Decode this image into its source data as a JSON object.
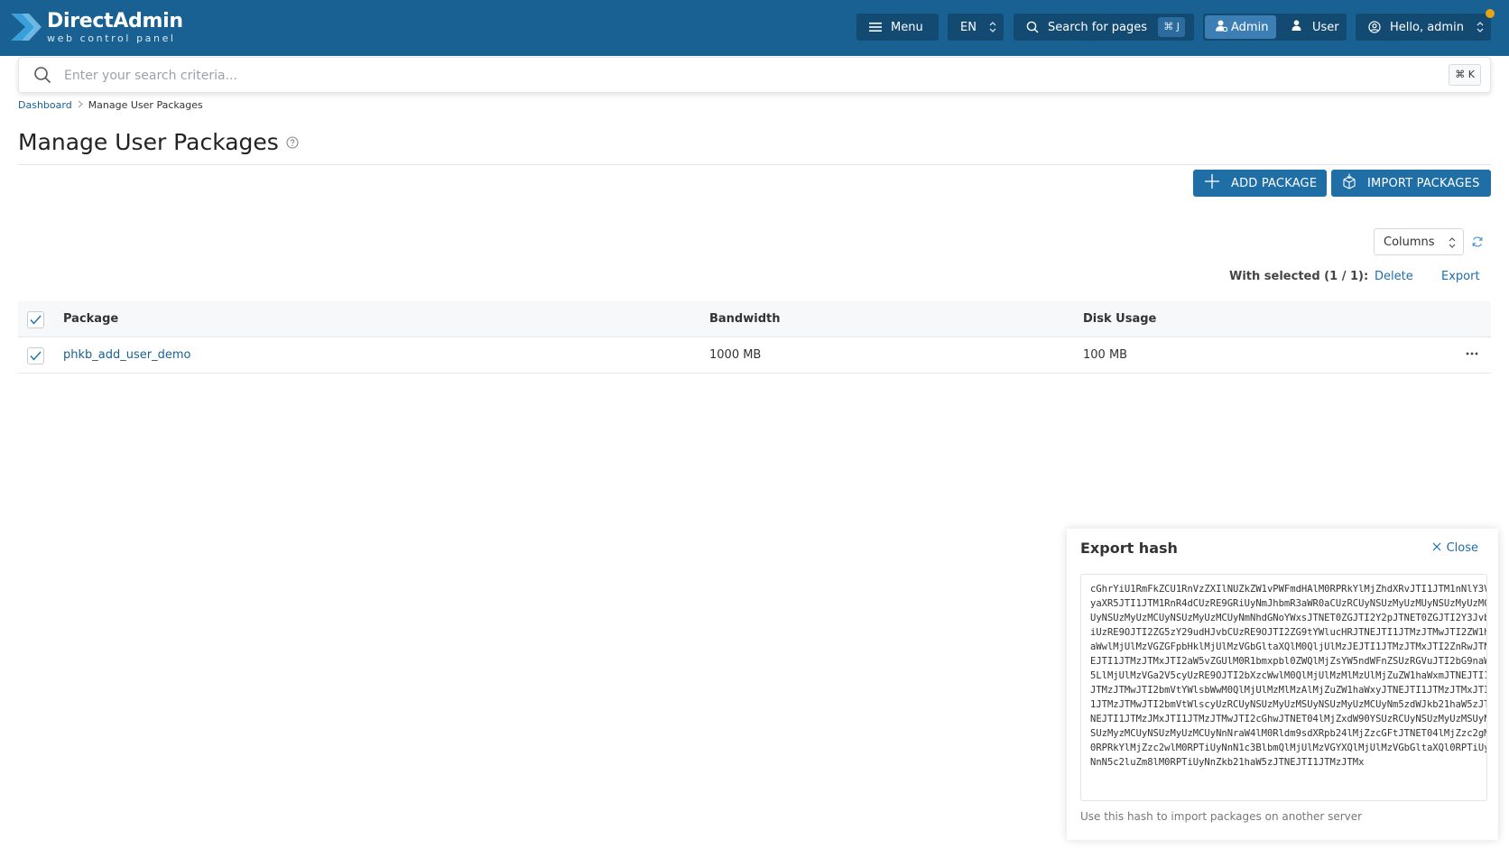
{
  "header": {
    "logo_title": "DirectAdmin",
    "logo_subtitle": "web control panel",
    "menu_label": "Menu",
    "language": "EN",
    "search_label": "Search for pages",
    "search_shortcut": "⌘ J",
    "role_admin": "Admin",
    "role_user": "User",
    "greeting": "Hello, admin",
    "brand_color": "#1a6193",
    "notification_color": "#e8a317"
  },
  "global_search": {
    "placeholder": "Enter your search criteria...",
    "shortcut": "⌘ K"
  },
  "breadcrumb": {
    "items": [
      "Dashboard",
      "Manage User Packages"
    ]
  },
  "page": {
    "title": "Manage User Packages"
  },
  "actions": {
    "add_package": "ADD PACKAGE",
    "import_packages": "IMPORT PACKAGES"
  },
  "table_controls": {
    "columns_label": "Columns",
    "with_selected": "With selected (1 / 1):",
    "delete": "Delete",
    "export": "Export"
  },
  "table": {
    "headers": [
      "Package",
      "Bandwidth",
      "Disk Usage"
    ],
    "rows": [
      {
        "package": "phkb_add_user_demo",
        "bandwidth": "1000 MB",
        "disk_usage": "100 MB",
        "selected": true
      }
    ]
  },
  "export_panel": {
    "title": "Export hash",
    "close_label": "Close",
    "hash": "cGhrYiU1RmFkZCU1RnVzZXIlNUZkZW1vPWFmdHAlM0RPRkYlMjZhdXRvJTI1JTM1nNlY3VyaXR5JTI1JTM1RnR4dCUzRE9GRiUyNmJhbmR3aWR0aCUzRCUyNSUzMyUzMUyNSUzMyUzMCUyNSUzMyUzMCUyNSUzMyUzMCUyNmNhdGNoYWxsJTNET0ZGJTI2Y2pJTNET0ZGJTI2Y3JvbiUzRE9OJTI2ZG5zY29udHJvbCUzRE9OJTI2ZG9tYWlucHRJTNEJTI1JTMzJTMwJTI2ZW1haWwlMjUlMzVGZGFpbHklMjUlMzVGbGltaXQlM0QljUlMzJEJTI1JTMzJTMxJTI2ZnRwJTNEJTI1JTMzJTMxJTI2aW5vZGUlM0R1bmxpbl0ZWQlMjZsYW5ndWFnZSUzRGVuJTI2bG9naW5LlMjUlMzVGa2V5cyUzRE9OJTI2bXzcWwlM0QlMjUlMzMlMzUlMjZuZW1haWxmJTNEJTI1JTMzJTMwJTI2bmVtYWlsbWwM0QlMjUlMzMlMzAlMjZuZW1haWxyJTNEJTI1JTMzJTMxJTI1JTMzJTMwJTI2bmVtWlscyUzRCUyNSUzMyUzMSUyNSUzMyUzMCUyNm5zdWJkb21haW5zJTNEJTI1JTMzJMxJTI1JTMzJTMwJTI2cGhwJTNET04lMjZxdW90YSUzRCUyNSUzMyUzMSUyNSUzMyzMCUyNSUzMyUzMCUyNnNraW4lM0Rldm9sdXRpb24lMjZzcGFtJTNET04lMjZzc2gM0RPRkYlMjZzc2wlM0RPTiUyNnN1c3BlbmQlMjUlMzVGYXQlMjUlMzVGbGltaXQl0RPTiUyNnN5c2luZm8lM0RPTiUyNnZkb21haW5zJTNEJTI1JTMzJTMx",
    "note": "Use this hash to import packages on another server"
  }
}
